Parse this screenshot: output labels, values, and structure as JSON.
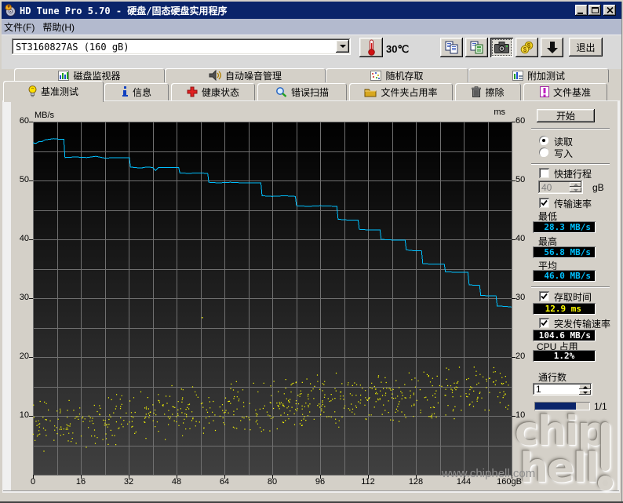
{
  "window": {
    "title": "HD Tune Pro 5.70 - 硬盘/固态硬盘实用程序"
  },
  "menu": {
    "file": "文件(F)",
    "help": "帮助(H)"
  },
  "toolbar": {
    "drive_select": "ST3160827AS (160 gB)",
    "temperature": "30℃",
    "exit_label": "退出"
  },
  "tabs": {
    "row1": [
      {
        "label": "磁盘监视器"
      },
      {
        "label": "自动噪音管理"
      },
      {
        "label": "随机存取"
      },
      {
        "label": "附加测试"
      }
    ],
    "row2": [
      {
        "label": "基准测试"
      },
      {
        "label": "信息"
      },
      {
        "label": "健康状态"
      },
      {
        "label": "错误扫描"
      },
      {
        "label": "文件夹占用率"
      },
      {
        "label": "擦除"
      },
      {
        "label": "文件基准"
      }
    ],
    "selected": "基准测试"
  },
  "panel": {
    "start_label": "开始",
    "read_label": "读取",
    "write_label": "写入",
    "short_stroke_label": "快捷行程",
    "short_stroke_value": "40",
    "short_stroke_unit": "gB",
    "transfer_rate_label": "传输速率",
    "min_label": "最低",
    "min_value": "28.3 MB/s",
    "max_label": "最高",
    "max_value": "56.8 MB/s",
    "avg_label": "平均",
    "avg_value": "46.0 MB/s",
    "access_time_label": "存取时间",
    "access_time_value": "12.9 ms",
    "burst_rate_label": "突发传输速率",
    "burst_rate_value": "104.6 MB/s",
    "cpu_label": "CPU 占用",
    "cpu_value": "1.2%",
    "pass_label": "通行数",
    "pass_value": "1",
    "progress_text": "1/1",
    "progress_fraction": 0.73
  },
  "watermark": {
    "logo_line1": "chip",
    "logo_line2": "hell",
    "url": "www.chiphell.com"
  },
  "chart_data": {
    "type": "line+scatter",
    "title": "",
    "x_axis": {
      "min": 0,
      "max": 160,
      "grid_step": 8,
      "tick_step": 16,
      "unit": "gB",
      "tick_labels": [
        "0",
        "16",
        "32",
        "48",
        "64",
        "80",
        "96",
        "112",
        "128",
        "144",
        "160gB"
      ]
    },
    "y_axis": {
      "min": 0,
      "max": 60,
      "grid_step": 5,
      "tick_step": 10,
      "left_title": "MB/s",
      "right_title": "ms",
      "tick_labels": [
        "60",
        "50",
        "40",
        "30",
        "20",
        "10"
      ]
    },
    "transfer_line": {
      "name": "read transfer rate",
      "color": "#00c0ff",
      "points": [
        [
          0,
          56.4
        ],
        [
          1,
          56.3
        ],
        [
          2,
          56.6
        ],
        [
          3,
          56.6
        ],
        [
          4,
          56.9
        ],
        [
          5.5,
          57.0
        ],
        [
          7,
          57.1
        ],
        [
          9,
          57.0
        ],
        [
          10.3,
          57.0
        ],
        [
          10.7,
          53.9
        ],
        [
          14,
          54.0
        ],
        [
          18,
          53.9
        ],
        [
          21,
          54.1
        ],
        [
          24,
          53.8
        ],
        [
          28,
          53.9
        ],
        [
          32.2,
          53.9
        ],
        [
          32.6,
          52.3
        ],
        [
          34,
          52.2
        ],
        [
          36,
          52.1
        ],
        [
          38,
          52.3
        ],
        [
          40,
          52.2
        ],
        [
          41,
          51.7
        ],
        [
          42,
          52.2
        ],
        [
          45,
          52.2
        ],
        [
          48.7,
          52.2
        ],
        [
          49.1,
          51.3
        ],
        [
          52,
          51.2
        ],
        [
          55,
          51.3
        ],
        [
          58.4,
          51.2
        ],
        [
          58.8,
          49.7
        ],
        [
          62,
          49.6
        ],
        [
          66,
          49.7
        ],
        [
          70,
          49.6
        ],
        [
          76.2,
          49.6
        ],
        [
          76.6,
          47.4
        ],
        [
          80,
          47.3
        ],
        [
          84,
          47.4
        ],
        [
          87.7,
          47.3
        ],
        [
          88.1,
          45.7
        ],
        [
          92,
          45.6
        ],
        [
          96,
          45.7
        ],
        [
          101.6,
          45.6
        ],
        [
          102,
          43.4
        ],
        [
          105,
          43.3
        ],
        [
          108.7,
          43.3
        ],
        [
          109.1,
          41.7
        ],
        [
          112,
          41.6
        ],
        [
          116,
          41.6
        ],
        [
          116.4,
          40.0
        ],
        [
          120,
          39.9
        ],
        [
          124.4,
          39.9
        ],
        [
          124.8,
          38.2
        ],
        [
          127,
          38.1
        ],
        [
          129.9,
          38.1
        ],
        [
          130.3,
          35.9
        ],
        [
          133,
          35.8
        ],
        [
          137.5,
          35.8
        ],
        [
          137.9,
          34.5
        ],
        [
          141,
          34.4
        ],
        [
          145.4,
          34.4
        ],
        [
          145.8,
          32.3
        ],
        [
          147.5,
          32.2
        ],
        [
          149.3,
          32.2
        ],
        [
          149.7,
          30.5
        ],
        [
          152,
          30.4
        ],
        [
          154.8,
          30.4
        ],
        [
          155.2,
          28.7
        ],
        [
          158,
          28.6
        ],
        [
          160,
          28.5
        ]
      ]
    },
    "access_scatter": {
      "name": "access time",
      "color": "#ffff00",
      "count": 680,
      "seed": 7,
      "center_start": 8.3,
      "center_end": 15.0,
      "spread": 5.0,
      "clamp": [
        3.6,
        19.6
      ],
      "outliers": [
        [
          56.6,
          26.7
        ]
      ]
    },
    "background": {
      "top": "#000000",
      "bottom": "#404040",
      "grid_color": "#707070"
    }
  }
}
